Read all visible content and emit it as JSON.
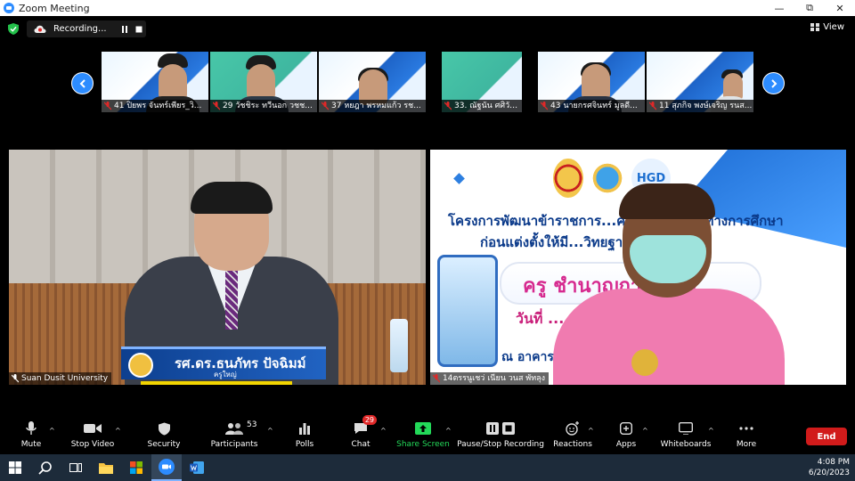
{
  "window": {
    "title": "Zoom Meeting",
    "minimize": "—",
    "restore": "⧉",
    "close": "✕"
  },
  "recording": {
    "label": "Recording...",
    "pause_icon": "pause-icon",
    "stop_icon": "stop-icon"
  },
  "view_button": {
    "label": "View"
  },
  "thumbnails": [
    {
      "name": "41 ปิยพร จันทร์เพียร_วิ..."
    },
    {
      "name": "29 วัชชิระ ทวีนอก วชช..."
    },
    {
      "name": "37 หยฎา พรหมแก้ว รช..."
    },
    {
      "name": "33. ณัฐนัน ศศิวัจนีฟลิฐ ..."
    },
    {
      "name": "43 นายกรศจินทร์ มูลดี..."
    },
    {
      "name": "11 สุภกิจ พงษ์เจริญ รนส..."
    }
  ],
  "video_left": {
    "name_caption": "รศ.ดร.ธนภัทร ปัจฉิมม์",
    "sub_caption": "ครูใหญ่",
    "label": "Suan Dusit University"
  },
  "video_right": {
    "label": "14ตรรนูเชว่ เนียน วนส พัทลุง",
    "slide": {
      "logo3": "HGD",
      "line1": "โครงการพัฒนาข้าราชการ...ครูและบุคลากรทางการศึกษา",
      "line2": "ก่อนแต่งตั้งให้มี...วิทยฐานะ",
      "banner": "ครู ชำนาญการพิเศษ",
      "date": "วันที่ ...",
      "venue": "ณ อาคาร..."
    }
  },
  "toolbar": {
    "mute": "Mute",
    "stop_video": "Stop Video",
    "security": "Security",
    "participants": "Participants",
    "participants_count": "53",
    "polls": "Polls",
    "chat": "Chat",
    "chat_badge": "29",
    "share_screen": "Share Screen",
    "pause_stop_recording": "Pause/Stop Recording",
    "reactions": "Reactions",
    "apps": "Apps",
    "whiteboards": "Whiteboards",
    "more": "More",
    "end": "End"
  },
  "taskbar": {
    "time": "4:08 PM",
    "date": "6/20/2023"
  },
  "colors": {
    "accent": "#2d8cff",
    "end": "#d11b1b",
    "share": "#23d959",
    "badge": "#e02828"
  }
}
